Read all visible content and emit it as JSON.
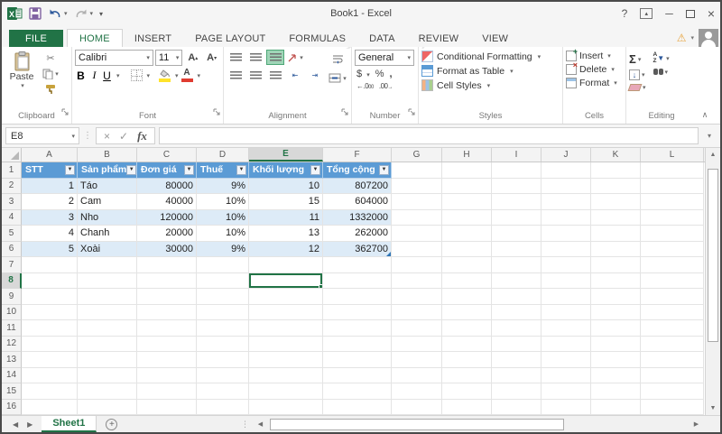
{
  "colors": {
    "excel_green": "#217346",
    "table_header_blue": "#5B9BD5",
    "band_blue": "#DDEBF7",
    "selection_green": "#217346"
  },
  "titlebar": {
    "title": "Book1 - Excel",
    "help": "?"
  },
  "tabs": [
    "FILE",
    "HOME",
    "INSERT",
    "PAGE LAYOUT",
    "FORMULAS",
    "DATA",
    "REVIEW",
    "VIEW"
  ],
  "active_tab": "HOME",
  "ribbon": {
    "clipboard": {
      "label": "Clipboard",
      "paste": "Paste"
    },
    "font": {
      "label": "Font",
      "name": "Calibri",
      "size": "11"
    },
    "alignment": {
      "label": "Alignment"
    },
    "number": {
      "label": "Number",
      "format": "General"
    },
    "styles": {
      "label": "Styles",
      "conditional": "Conditional Formatting",
      "format_table": "Format as Table",
      "cell_styles": "Cell Styles"
    },
    "cells": {
      "label": "Cells",
      "insert": "Insert",
      "delete": "Delete",
      "format": "Format"
    },
    "editing": {
      "label": "Editing"
    }
  },
  "formula_bar": {
    "name_box": "E8",
    "fx": "fx"
  },
  "grid": {
    "columns": [
      "A",
      "B",
      "C",
      "D",
      "E",
      "F",
      "G",
      "H",
      "I",
      "J",
      "K",
      "L"
    ],
    "row_count": 16,
    "selection": {
      "cell": "E8",
      "column": "E",
      "row": 8
    },
    "table": {
      "headers": [
        "STT",
        "Sản phẩm",
        "Đơn giá",
        "Thuế",
        "Khối lượng",
        "Tổng cộng"
      ],
      "rows": [
        [
          "1",
          "Táo",
          "80000",
          "9%",
          "10",
          "807200"
        ],
        [
          "2",
          "Cam",
          "40000",
          "10%",
          "15",
          "604000"
        ],
        [
          "3",
          "Nho",
          "120000",
          "10%",
          "11",
          "1332000"
        ],
        [
          "4",
          "Chanh",
          "20000",
          "10%",
          "13",
          "262000"
        ],
        [
          "5",
          "Xoài",
          "30000",
          "9%",
          "12",
          "362700"
        ]
      ]
    }
  },
  "sheet_bar": {
    "active_sheet": "Sheet1"
  }
}
